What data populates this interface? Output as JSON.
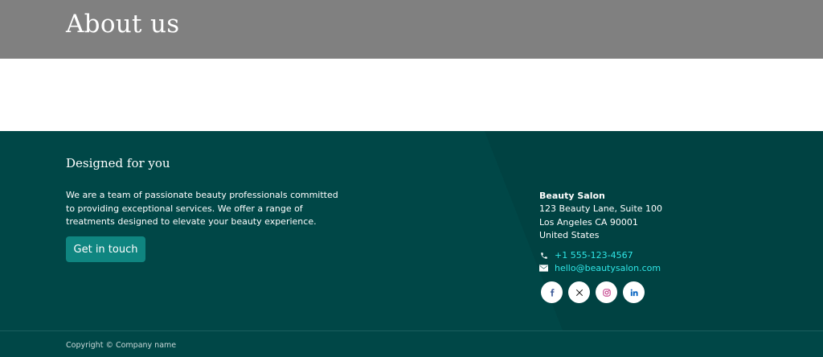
{
  "hero": {
    "title": "About us"
  },
  "footer": {
    "heading": "Designed for you",
    "description": "We are a team of passionate beauty professionals committed to providing exceptional services. We offer a range of treatments designed to elevate your beauty experience.",
    "cta_label": "Get in touch",
    "address": {
      "name": "Beauty Salon",
      "line1": "123 Beauty Lane, Suite 100",
      "line2": "Los Angeles CA 90001",
      "line3": "United States"
    },
    "phone": "+1 555-123-4567",
    "email": "hello@beautysalon.com",
    "socials": [
      {
        "icon": "facebook-icon",
        "color": "#3b5998"
      },
      {
        "icon": "x-twitter-icon",
        "color": "#222222"
      },
      {
        "icon": "instagram-icon",
        "color": "#c13584"
      },
      {
        "icon": "linkedin-icon",
        "color": "#0a66c2"
      }
    ],
    "copyright": "Copyright © Company name"
  },
  "colors": {
    "hero_bg": "#808080",
    "footer_bg": "#004747",
    "accent_button": "#0f8580",
    "link": "#2ee6e6"
  }
}
